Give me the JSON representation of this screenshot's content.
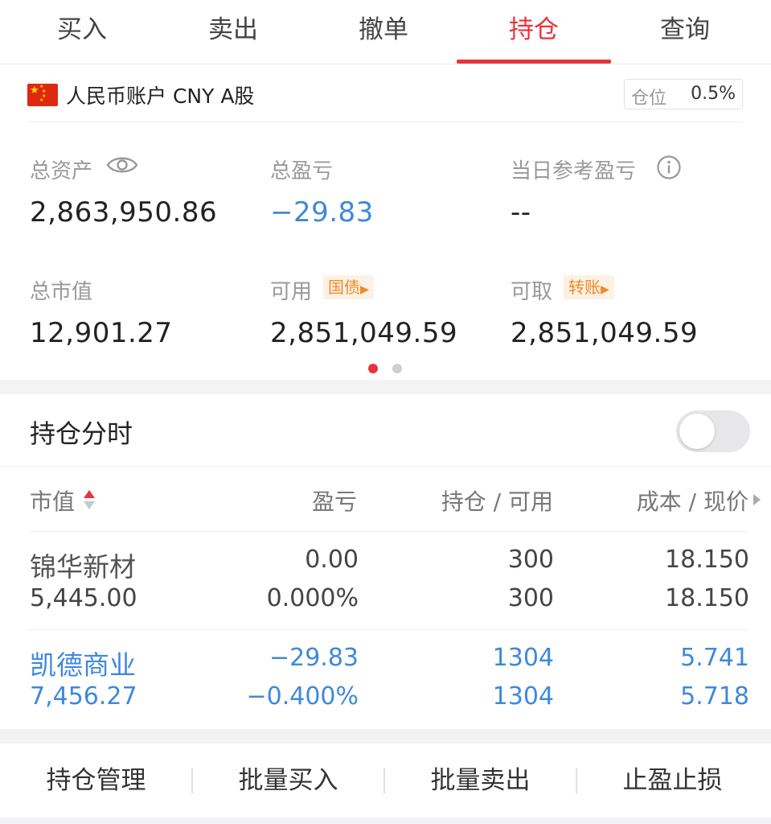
{
  "tabs": [
    {
      "label": "买入",
      "active": false
    },
    {
      "label": "卖出",
      "active": false
    },
    {
      "label": "撤单",
      "active": false
    },
    {
      "label": "持仓",
      "active": true
    },
    {
      "label": "查询",
      "active": false
    }
  ],
  "account": {
    "name": "人民币账户 CNY A股",
    "position_label": "仓位",
    "position_value": "0.5%"
  },
  "summary": {
    "total_assets_label": "总资产",
    "total_assets_value": "2,863,950.86",
    "total_pnl_label": "总盈亏",
    "total_pnl_value": "−29.83",
    "today_pnl_label": "当日参考盈亏",
    "today_pnl_value": "--",
    "market_value_label": "总市值",
    "market_value_value": "12,901.27",
    "available_label": "可用",
    "available_tag": "国债",
    "available_value": "2,851,049.59",
    "withdrawable_label": "可取",
    "withdrawable_tag": "转账",
    "withdrawable_value": "2,851,049.59"
  },
  "pager": {
    "active_index": 0,
    "count": 2
  },
  "timeshare": {
    "label": "持仓分时",
    "enabled": false
  },
  "holdings": {
    "headers": {
      "market_value": "市值",
      "pnl": "盈亏",
      "position": "持仓 / 可用",
      "cost": "成本 / 现价"
    },
    "rows": [
      {
        "name": "锦华新材",
        "market_value": "5,445.00",
        "pnl": "0.00",
        "pnl_pct": "0.000%",
        "position": "300",
        "available": "300",
        "cost": "18.150",
        "price": "18.150"
      },
      {
        "name": "凯德商业",
        "market_value": "7,456.27",
        "pnl": "−29.83",
        "pnl_pct": "−0.400%",
        "position": "1304",
        "available": "1304",
        "cost": "5.741",
        "price": "5.718"
      }
    ]
  },
  "actions": [
    {
      "label": "持仓管理"
    },
    {
      "label": "批量买入"
    },
    {
      "label": "批量卖出"
    },
    {
      "label": "止盈止损"
    }
  ],
  "colors": {
    "accent_red": "#e8333b",
    "loss_blue": "#3e89dc",
    "tag_orange": "#f08a24"
  }
}
